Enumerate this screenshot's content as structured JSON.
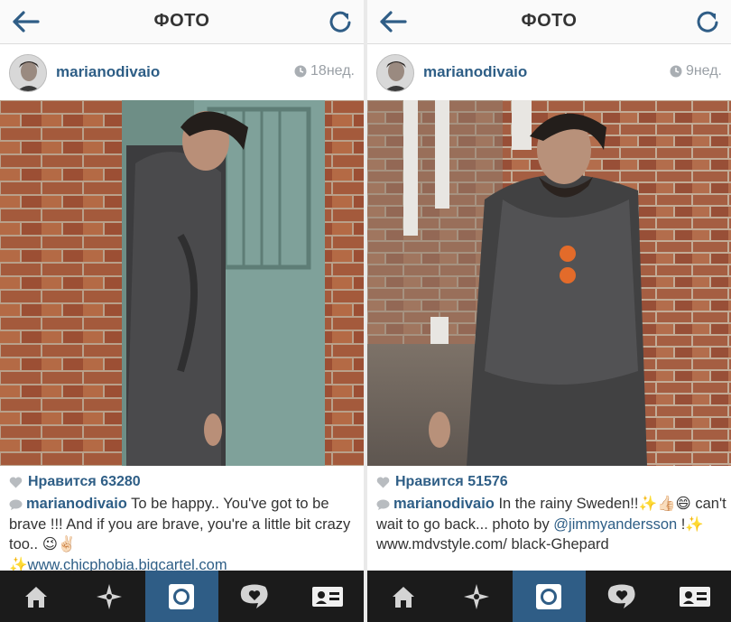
{
  "left": {
    "topbar": {
      "title": "ФОТО"
    },
    "post": {
      "username": "marianodivaio",
      "time": "18нед.",
      "likes": "Нравится 63280",
      "caption_user": "marianodivaio",
      "caption_text": " To be happy.. You've got to be brave !!! And if you are brave, you're a little bit crazy too.. 😉✌🏻",
      "caption_link": "✨www.chicphobia.bigcartel.com"
    }
  },
  "right": {
    "topbar": {
      "title": "ФОТО"
    },
    "post": {
      "username": "marianodivaio",
      "time": "9нед.",
      "likes": "Нравится 51576",
      "caption_user": "marianodivaio",
      "caption_text": " In the rainy Sweden!!✨👍🏻😄 can't wait to go back... photo by ",
      "caption_mention": "@jimmyandersson",
      "caption_text2": " !✨ www.mdvstyle.com/ black-Ghepard"
    }
  },
  "tabbar": {
    "items": [
      "home-icon",
      "explore-icon",
      "camera-icon",
      "activity-icon",
      "profile-icon"
    ],
    "active_index": 2
  },
  "colors": {
    "accent": "#2f5d86",
    "link": "#2e5e86",
    "tabbar_bg": "#1b1b1b",
    "topbar_bg": "#fafafa"
  }
}
